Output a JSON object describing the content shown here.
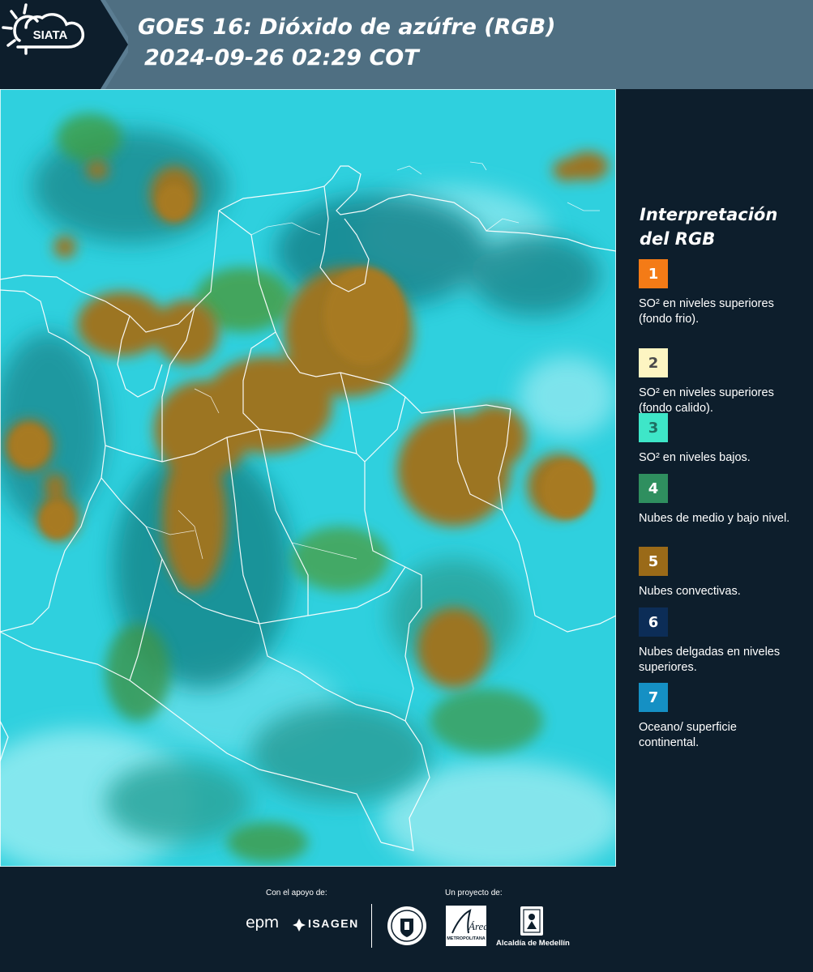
{
  "header": {
    "logo_text": "SIATA",
    "title_line1": "GOES 16: Dióxido de azúfre (RGB)",
    "title_line2": "2024-09-26 02:29 COT"
  },
  "legend": {
    "title_line1": "Interpretación",
    "title_line2": "del RGB",
    "items": [
      {
        "number": "1",
        "color": "#f47b16",
        "text_color": "#ffffff",
        "text": "SO² en niveles superiores (fondo frio)."
      },
      {
        "number": "2",
        "color": "#fdf5c2",
        "text_color": "#4a4a4a",
        "text": "SO² en niveles superiores (fondo calido)."
      },
      {
        "number": "3",
        "color": "#3ee6c8",
        "text_color": "#1e6e62",
        "text": "SO² en niveles bajos."
      },
      {
        "number": "4",
        "color": "#2f8f5f",
        "text_color": "#ffffff",
        "text": "Nubes de medio y bajo nivel."
      },
      {
        "number": "5",
        "color": "#9a6a18",
        "text_color": "#ffffff",
        "text": "Nubes convectivas."
      },
      {
        "number": "6",
        "color": "#0c2d57",
        "text_color": "#ffffff",
        "text": "Nubes delgadas en niveles superiores."
      },
      {
        "number": "7",
        "color": "#1590c4",
        "text_color": "#ffffff",
        "text": "Oceano/ superficie continental."
      }
    ]
  },
  "footer": {
    "support_label": "Con el apoyo de:",
    "project_label": "Un proyecto de:",
    "sponsor_epm": "epm",
    "sponsor_isagen": "ISAGEN",
    "area_label": "Área",
    "area_sub": "METROPOLITANA",
    "medellin_label": "Alcaldía de Medellín"
  }
}
